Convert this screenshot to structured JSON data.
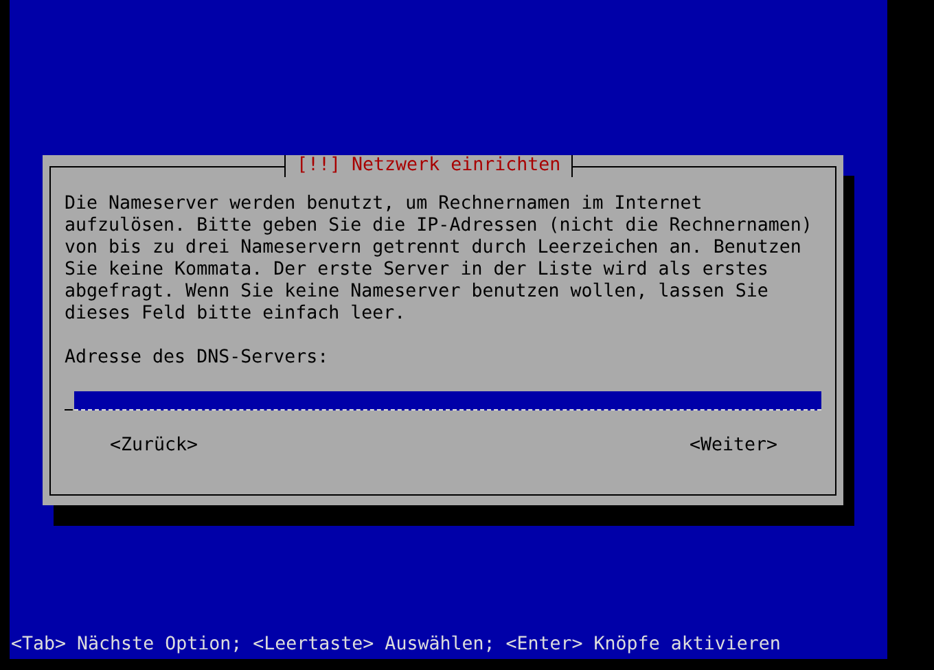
{
  "dialog": {
    "title": "[!!] Netzwerk einrichten",
    "message": "Die Nameserver werden benutzt, um Rechnernamen im Internet\naufzulösen. Bitte geben Sie die IP-Adressen (nicht die Rechnernamen)\nvon bis zu drei Nameservern getrennt durch Leerzeichen an. Benutzen\nSie keine Kommata. Der erste Server in der Liste wird als erstes\nabgefragt. Wenn Sie keine Nameserver benutzen wollen, lassen Sie\ndieses Feld bitte einfach leer.",
    "field": {
      "label": "Adresse des DNS-Servers:",
      "focused": true
    },
    "buttons": [
      {
        "label": "<Zurück>",
        "selected": false
      },
      {
        "label": "<Weiter>",
        "selected": false
      }
    ]
  },
  "help_bar": "<Tab> Nächste Option; <Leertaste> Auswählen; <Enter> Knöpfe aktivieren"
}
